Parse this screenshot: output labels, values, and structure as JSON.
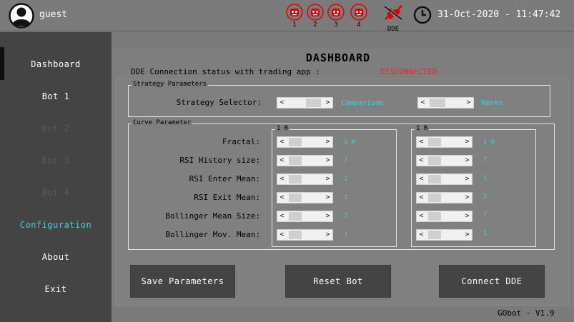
{
  "header": {
    "username": "guest",
    "bots": [
      {
        "label": "1",
        "icon": "robot-icon"
      },
      {
        "label": "2",
        "icon": "robot-icon"
      },
      {
        "label": "3",
        "icon": "robot-icon"
      },
      {
        "label": "4",
        "icon": "robot-icon"
      }
    ],
    "dde_label": "DDE",
    "datetime": "31-Oct-2020 - 11:47:42",
    "colors": {
      "status_red": "#ff2020",
      "accent": "#39d3e6"
    }
  },
  "sidebar": {
    "items": [
      {
        "label": "Dashboard",
        "state": "selected"
      },
      {
        "label": "Bot 1",
        "state": "normal"
      },
      {
        "label": "Bot 2",
        "state": "disabled"
      },
      {
        "label": "Bot 3",
        "state": "disabled"
      },
      {
        "label": "Bot 4",
        "state": "disabled"
      },
      {
        "label": "Configuration",
        "state": "active"
      },
      {
        "label": "About",
        "state": "normal"
      },
      {
        "label": "Exit",
        "state": "normal"
      }
    ]
  },
  "main": {
    "title": "DASHBOARD",
    "connection_label": "DDE Connection status with trading app :",
    "connection_status": "DISCONNECTED",
    "strategy": {
      "group_title": "Strategy Parameters",
      "selector_label": "Strategy Selector:",
      "left_value": "Comparison",
      "right_value": "Renko"
    },
    "curve": {
      "group_title": "Curve Parameter",
      "left_column_title": "1 R",
      "right_column_title": "1 R",
      "rows": [
        {
          "label": "Fractal:",
          "left": "1 R",
          "right": "1 R"
        },
        {
          "label": "RSI History size:",
          "left": "7",
          "right": "7"
        },
        {
          "label": "RSI Enter Mean:",
          "left": "1",
          "right": "1"
        },
        {
          "label": "RSI Exit Mean:",
          "left": "1",
          "right": "1"
        },
        {
          "label": "Bollinger Mean Size:",
          "left": "7",
          "right": "7"
        },
        {
          "label": "Bollinger Mov. Mean:",
          "left": "1",
          "right": "1"
        }
      ]
    },
    "buttons": {
      "save": "Save Parameters",
      "reset": "Reset Bot",
      "connect": "Connect DDE"
    },
    "version": "GObot - V1.9"
  }
}
